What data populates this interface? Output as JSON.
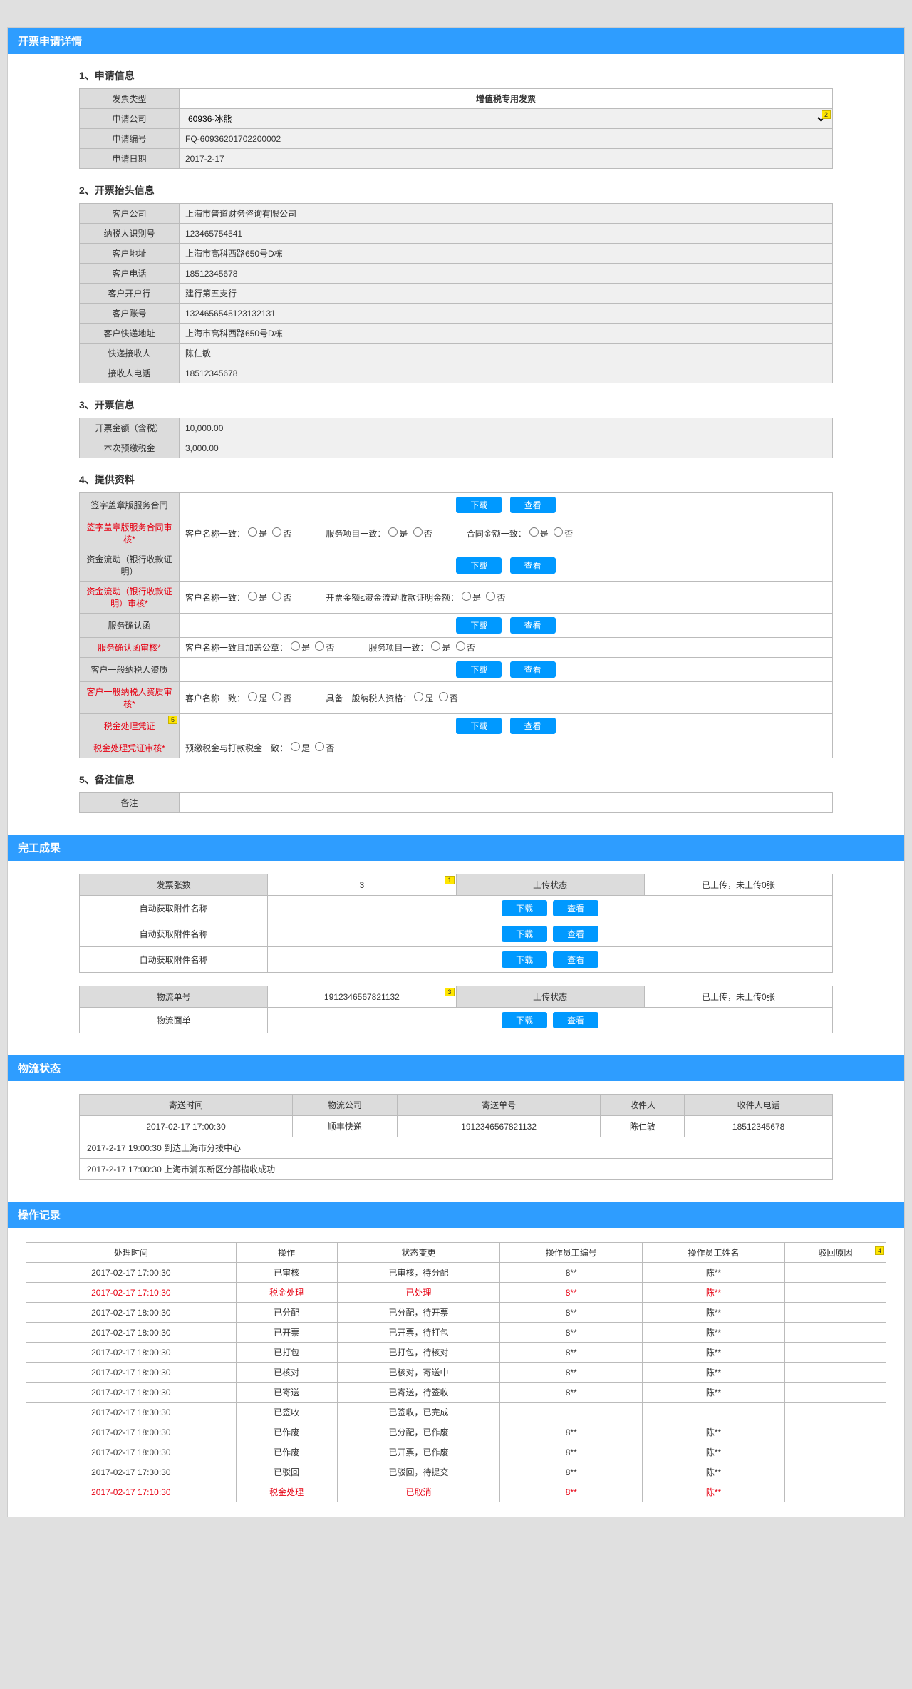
{
  "headers": {
    "detail": "开票申请详情",
    "result": "完工成果",
    "logistics": "物流状态",
    "log": "操作记录"
  },
  "section1": {
    "title": "1、申请信息",
    "labels": {
      "type": "发票类型",
      "company": "申请公司",
      "number": "申请编号",
      "date": "申请日期"
    },
    "values": {
      "type": "增值税专用发票",
      "company": "60936-冰熊",
      "number": "FQ-60936201702200002",
      "date": "2017-2-17"
    },
    "tag2": "2"
  },
  "section2": {
    "title": "2、开票抬头信息",
    "labels": {
      "cust": "客户公司",
      "taxid": "纳税人识别号",
      "addr": "客户地址",
      "tel": "客户电话",
      "bank": "客户开户行",
      "acct": "客户账号",
      "expraddr": "客户快递地址",
      "recv": "快递接收人",
      "recvtel": "接收人电话"
    },
    "values": {
      "cust": "上海市普道财务咨询有限公司",
      "taxid": "123465754541",
      "addr": "上海市高科西路650号D栋",
      "tel": "18512345678",
      "bank": "建行第五支行",
      "acct": "1324656545123132131",
      "expraddr": "上海市高科西路650号D栋",
      "recv": "陈仁敏",
      "recvtel": "18512345678"
    }
  },
  "section3": {
    "title": "3、开票信息",
    "labels": {
      "amount": "开票金额（含税）",
      "prepay": "本次预缴税金"
    },
    "values": {
      "amount": "10,000.00",
      "prepay": "3,000.00"
    }
  },
  "section4": {
    "title": "4、提供资料",
    "labels": {
      "r1": "签字盖章版服务合同",
      "r2": "签字盖章版服务合同审核*",
      "r3": "资金流动（银行收款证明）",
      "r4": "资金流动（银行收款证明）审核*",
      "r5": "服务确认函",
      "r6": "服务确认函审核*",
      "r7": "客户一般纳税人资质",
      "r8": "客户一般纳税人资质审核*",
      "r9": "税金处理凭证",
      "r10": "税金处理凭证审核*"
    },
    "tag5": "5",
    "checks": {
      "custname": "客户名称一致：",
      "svcitem": "服务项目一致：",
      "amount": "合同金额一致：",
      "fundamt": "开票金额≤资金流动收款证明金额：",
      "stamp": "客户名称一致且加盖公章：",
      "taxqual": "具备一般纳税人资格：",
      "prepaytax": "预缴税金与打款税金一致："
    },
    "opts": {
      "yes": "是",
      "no": "否"
    },
    "btns": {
      "download": "下载",
      "view": "查看"
    }
  },
  "section5": {
    "title": "5、备注信息",
    "label": "备注"
  },
  "result_tables": {
    "a": {
      "headers": {
        "count": "发票张数",
        "status": "上传状态"
      },
      "values": {
        "count": "3",
        "status": "已上传，未上传0张"
      },
      "tag1": "1",
      "rows": [
        {
          "name": "自动获取附件名称"
        },
        {
          "name": "自动获取附件名称"
        },
        {
          "name": "自动获取附件名称"
        }
      ]
    },
    "b": {
      "headers": {
        "trackno": "物流单号",
        "status": "上传状态"
      },
      "values": {
        "trackno": "1912346567821132",
        "status": "已上传，未上传0张"
      },
      "tag3": "3",
      "row": "物流面单"
    }
  },
  "logistics": {
    "headers": {
      "time": "寄送时间",
      "company": "物流公司",
      "no": "寄送单号",
      "recv": "收件人",
      "tel": "收件人电话"
    },
    "row": {
      "time": "2017-02-17  17:00:30",
      "company": "顺丰快递",
      "no": "1912346567821132",
      "recv": "陈仁敏",
      "tel": "18512345678"
    },
    "timeline": [
      "2017-2-17  19:00:30    到达上海市分拨中心",
      "2017-2-17  17:00:30    上海市浦东新区分部揽收成功"
    ]
  },
  "log": {
    "headers": {
      "time": "处理时间",
      "op": "操作",
      "state": "状态变更",
      "empid": "操作员工编号",
      "empname": "操作员工姓名",
      "reason": "驳回原因"
    },
    "tag4": "4",
    "rows": [
      {
        "time": "2017-02-17  17:00:30",
        "op": "已审核",
        "state": "已审核，待分配",
        "empid": "8**",
        "empname": "陈**",
        "reason": "",
        "red": false
      },
      {
        "time": "2017-02-17  17:10:30",
        "op": "税金处理",
        "state": "已处理",
        "empid": "8**",
        "empname": "陈**",
        "reason": "",
        "red": true
      },
      {
        "time": "2017-02-17  18:00:30",
        "op": "已分配",
        "state": "已分配，待开票",
        "empid": "8**",
        "empname": "陈**",
        "reason": "",
        "red": false
      },
      {
        "time": "2017-02-17  18:00:30",
        "op": "已开票",
        "state": "已开票，待打包",
        "empid": "8**",
        "empname": "陈**",
        "reason": "",
        "red": false
      },
      {
        "time": "2017-02-17  18:00:30",
        "op": "已打包",
        "state": "已打包，待核对",
        "empid": "8**",
        "empname": "陈**",
        "reason": "",
        "red": false
      },
      {
        "time": "2017-02-17  18:00:30",
        "op": "已核对",
        "state": "已核对，寄送中",
        "empid": "8**",
        "empname": "陈**",
        "reason": "",
        "red": false
      },
      {
        "time": "2017-02-17  18:00:30",
        "op": "已寄送",
        "state": "已寄送，待签收",
        "empid": "8**",
        "empname": "陈**",
        "reason": "",
        "red": false
      },
      {
        "time": "2017-02-17  18:30:30",
        "op": "已签收",
        "state": "已签收，已完成",
        "empid": "",
        "empname": "",
        "reason": "",
        "red": false
      },
      {
        "time": "2017-02-17  18:00:30",
        "op": "已作废",
        "state": "已分配，已作废",
        "empid": "8**",
        "empname": "陈**",
        "reason": "",
        "red": false
      },
      {
        "time": "2017-02-17  18:00:30",
        "op": "已作废",
        "state": "已开票，已作废",
        "empid": "8**",
        "empname": "陈**",
        "reason": "",
        "red": false
      },
      {
        "time": "2017-02-17  17:30:30",
        "op": "已驳回",
        "state": "已驳回，待提交",
        "empid": "8**",
        "empname": "陈**",
        "reason": "",
        "red": false
      },
      {
        "time": "2017-02-17  17:10:30",
        "op": "税金处理",
        "state": "已取消",
        "empid": "8**",
        "empname": "陈**",
        "reason": "",
        "red": true
      }
    ]
  }
}
